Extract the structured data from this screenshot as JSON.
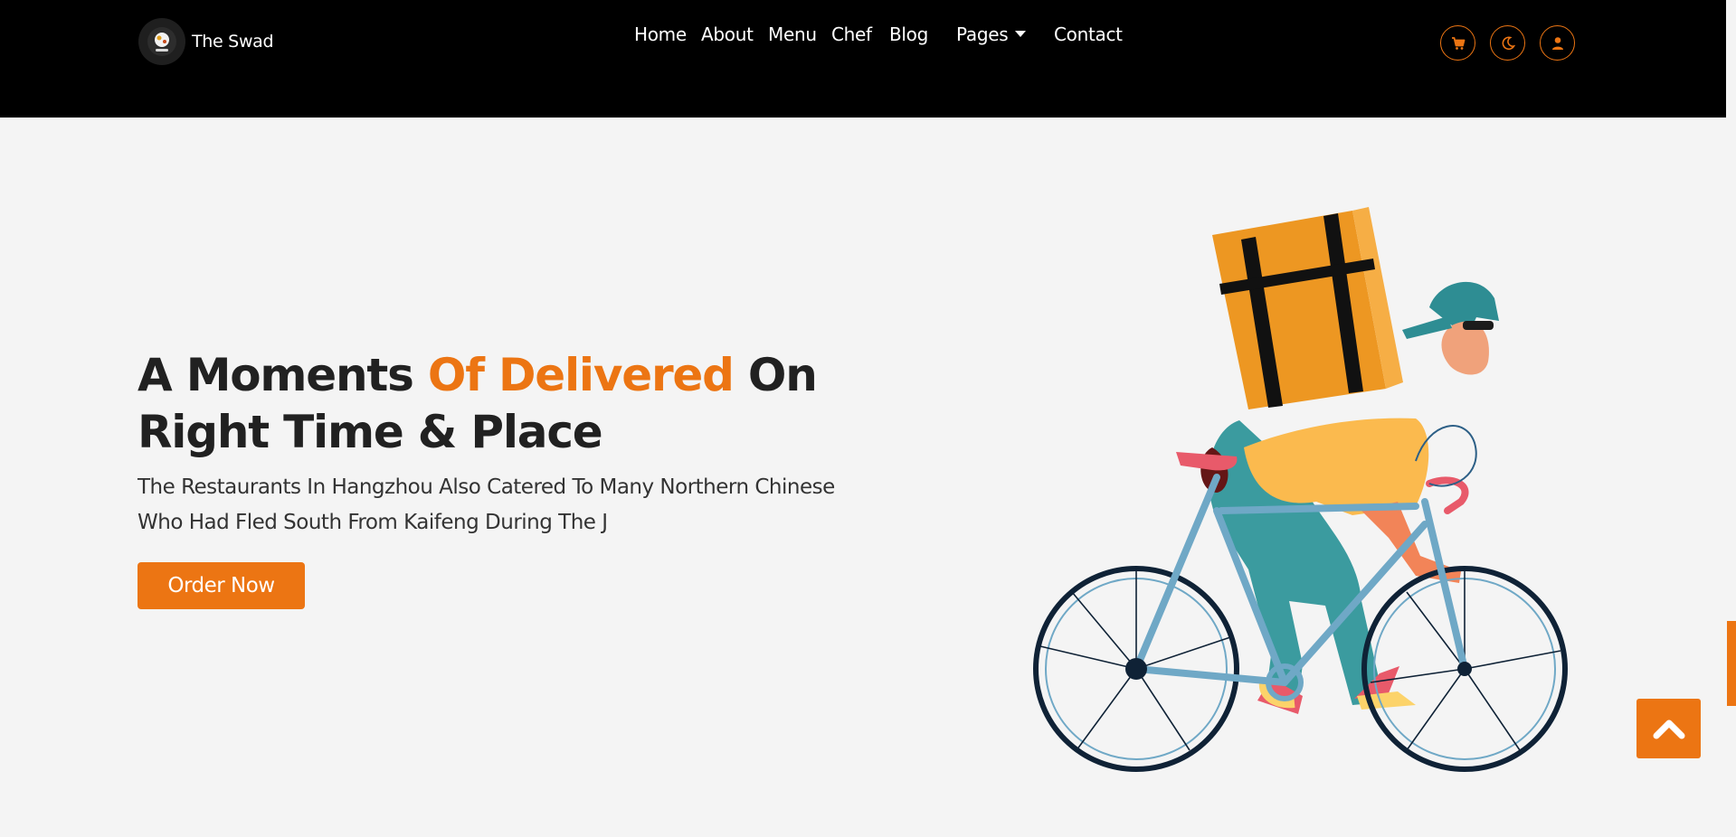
{
  "brand": {
    "name": "The Swad"
  },
  "nav": {
    "home": "Home",
    "about": "About",
    "menu": "Menu",
    "chef": "Chef",
    "blog": "Blog",
    "pages": "Pages",
    "contact": "Contact"
  },
  "icons": {
    "cart": "cart-icon",
    "theme": "moon-icon",
    "user": "user-icon",
    "scroll_top": "chevron-up-icon"
  },
  "hero": {
    "title_part1": "A Moments ",
    "title_accent": "Of Delivered",
    "title_part2": " On Right Time & Place",
    "description": "The Restaurants In Hangzhou Also Catered To Many Northern Chinese Who Had Fled South From Kaifeng During The J",
    "button": "Order Now"
  },
  "colors": {
    "accent": "#ec7513",
    "navbar_bg": "#000000",
    "page_bg": "#f4f4f4",
    "heading": "#212121"
  }
}
